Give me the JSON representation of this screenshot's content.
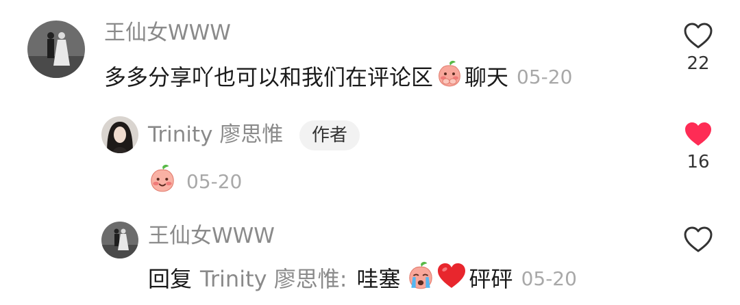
{
  "comments": [
    {
      "author": "王仙女WWW",
      "text": "多多分享吖也可以和我们在评论区",
      "text_after": "聊天",
      "emoji": "peach-shy-emoji",
      "time": "05-20",
      "likes": "22",
      "liked": false
    },
    {
      "author": "Trinity 廖思惟",
      "badge": "作者",
      "emoji": "peach-smile-emoji",
      "time": "05-20",
      "likes": "16",
      "liked": true
    },
    {
      "author": "王仙女WWW",
      "reply_prefix": "回复",
      "reply_to": "Trinity 廖思惟:",
      "text": "哇塞",
      "text_after": "砰砰",
      "emojis": [
        "peach-cry-emoji",
        "red-heart-emoji"
      ],
      "time": "05-20",
      "liked": false
    }
  ],
  "colors": {
    "liked": "#fe2c55",
    "name": "#8a8a8a",
    "time": "#a8a8a8"
  }
}
